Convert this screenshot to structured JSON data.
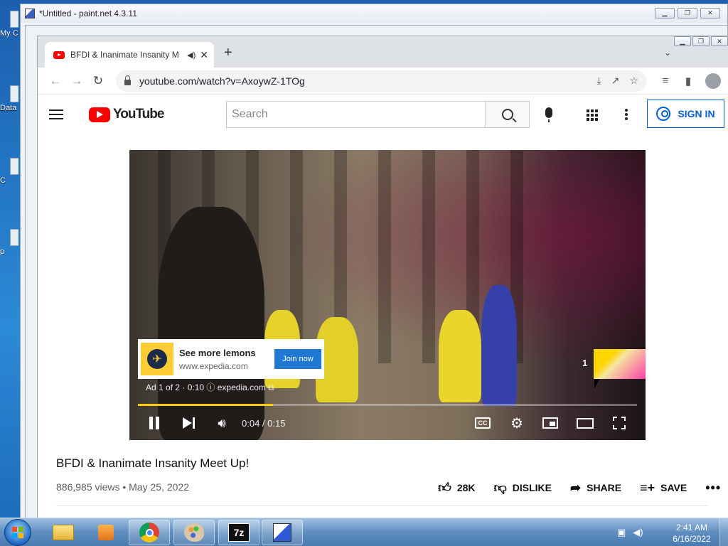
{
  "desktop": {
    "icons": [
      "My C",
      "Data",
      "C",
      "p"
    ]
  },
  "paint_net": {
    "title": "*Untitled - paint.net 4.3.11"
  },
  "chrome": {
    "tab_title": "BFDI & Inanimate Insanity M",
    "tab_audio_icon": "speaker-icon",
    "new_tab_label": "+",
    "url": "youtube.com/watch?v=AxoywZ-1TOg"
  },
  "youtube": {
    "logo_text": "YouTube",
    "search_placeholder": "Search",
    "sign_in_label": "SIGN IN"
  },
  "ad": {
    "title": "See more lemons",
    "domain": "www.expedia.com",
    "cta": "Join now",
    "info_prefix": "Ad 1 of 2 · 0:10",
    "info_link": "expedia.com",
    "countdown": "1",
    "brand_color": "#fbcc33"
  },
  "player": {
    "time": "0:04 / 0:15",
    "progress": 0.27,
    "progress_color": "#ffcc00",
    "cc_label": "CC"
  },
  "video": {
    "title": "BFDI & Inanimate Insanity Meet Up!",
    "meta": "886,985 views • May 25, 2022",
    "likes": "28K",
    "dislike_label": "DISLIKE",
    "share_label": "SHARE",
    "save_label": "SAVE"
  },
  "taskbar": {
    "apps": [
      "file-explorer",
      "media-player",
      "chrome",
      "paint",
      "7-zip",
      "paint.net"
    ],
    "sevenzip_label": "7z",
    "clock_time": "2:41 AM",
    "clock_date": "6/16/2022"
  }
}
